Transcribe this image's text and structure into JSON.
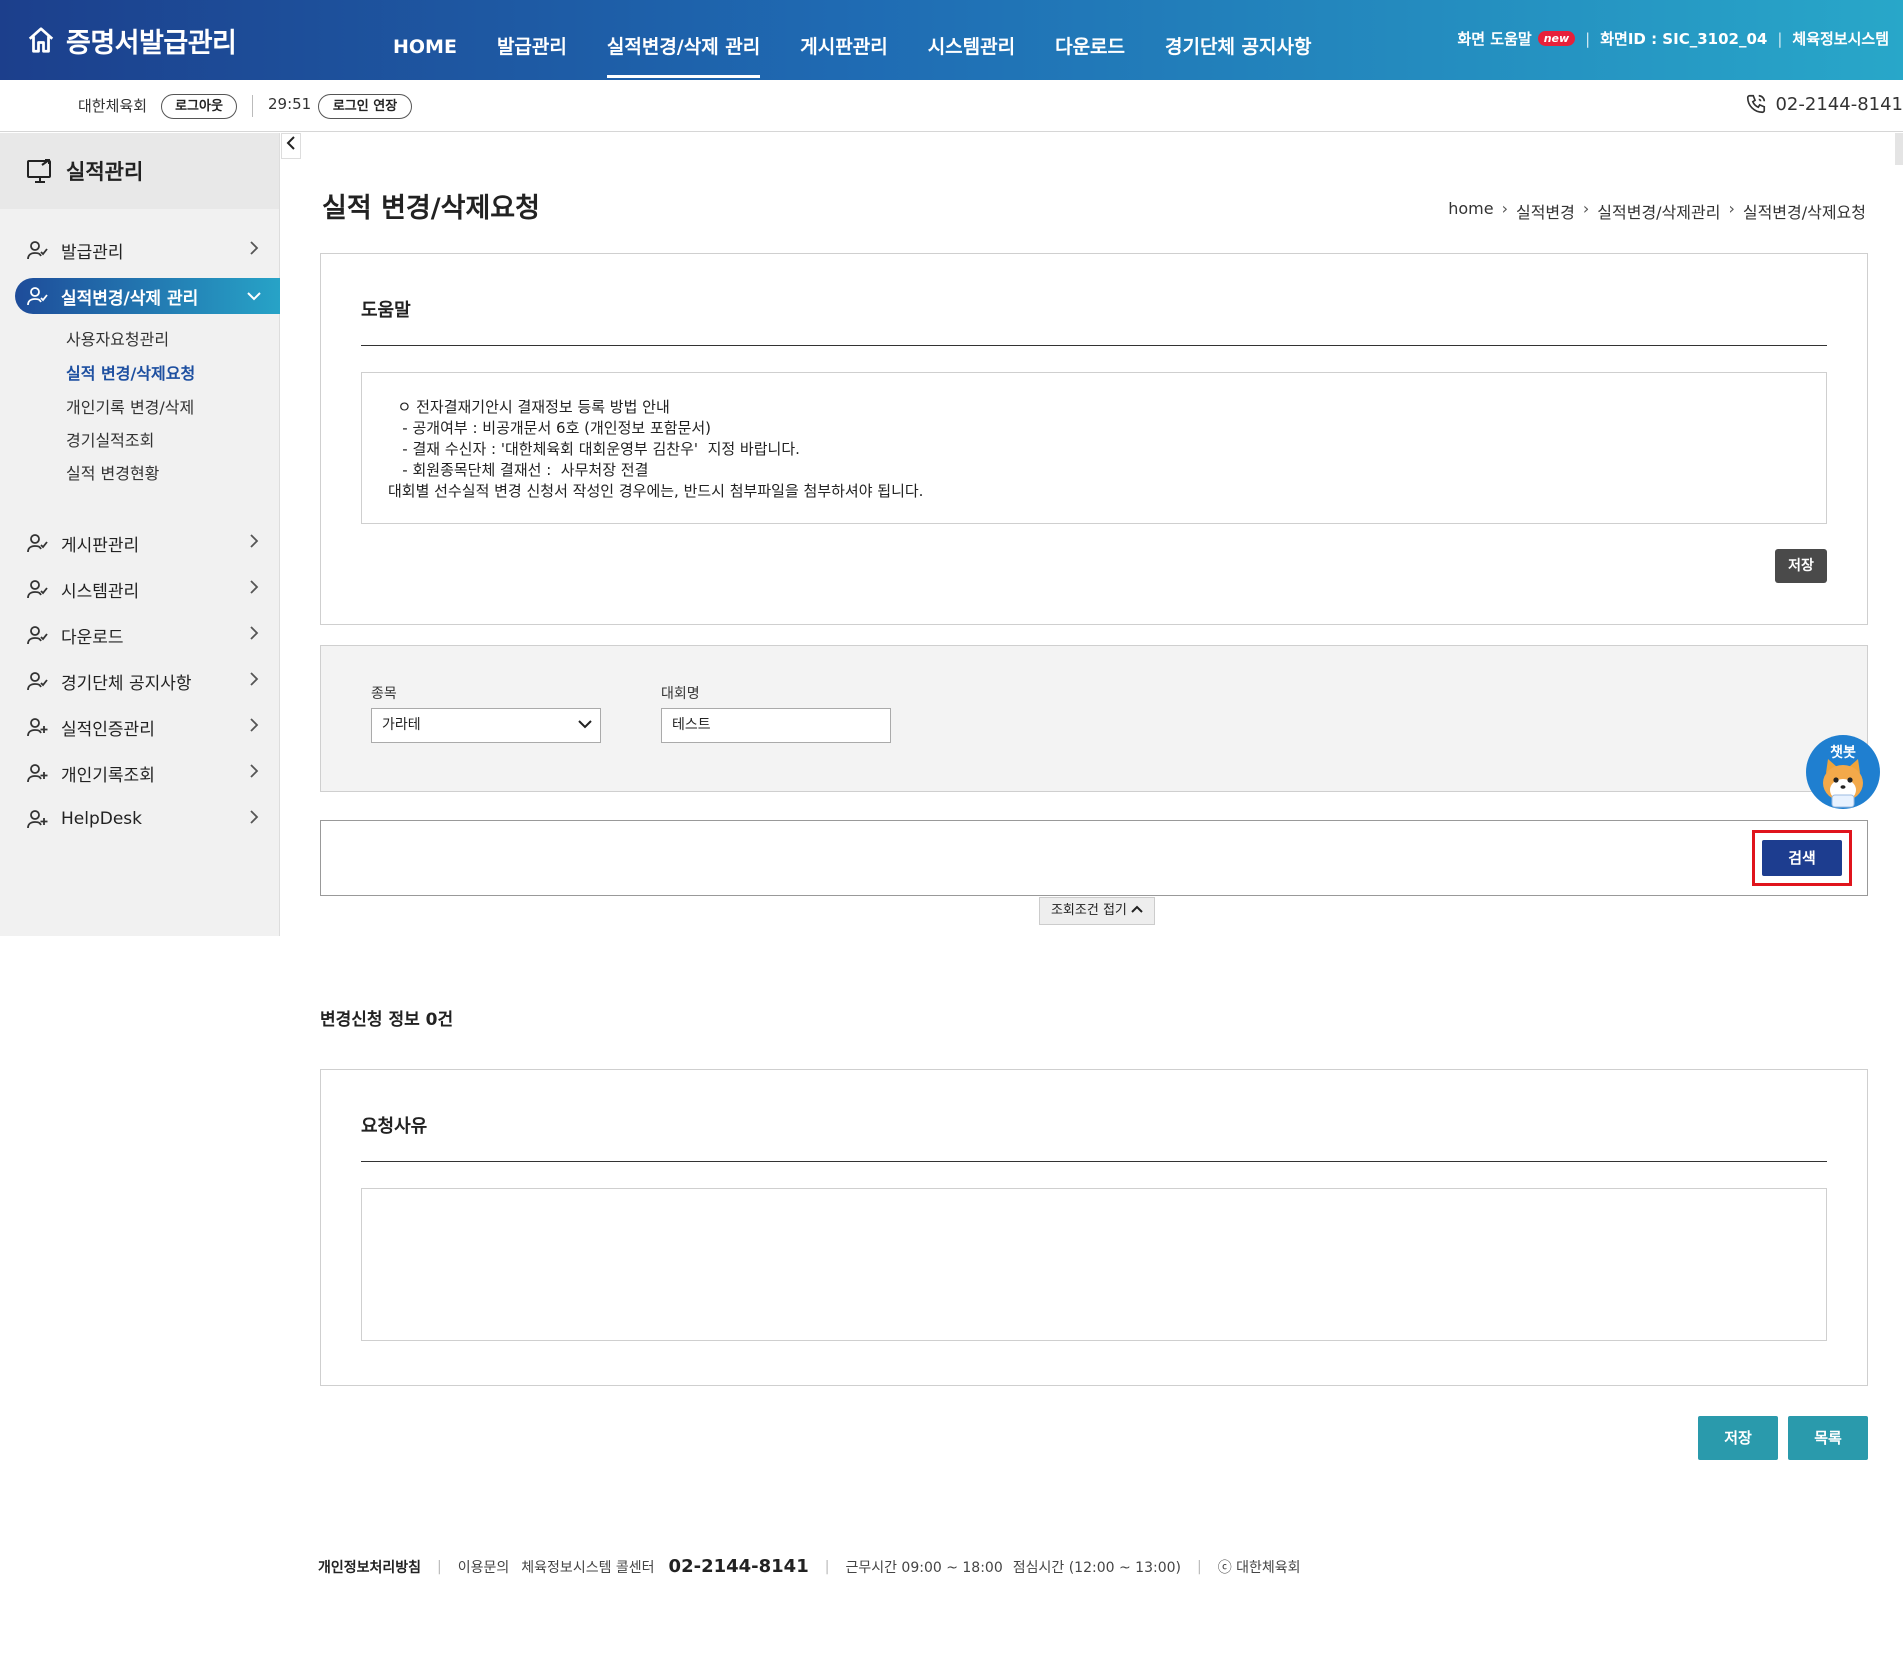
{
  "header": {
    "app_title": "증명서발급관리",
    "nav": [
      "HOME",
      "발급관리",
      "실적변경/삭제 관리",
      "게시판관리",
      "시스템관리",
      "다운로드",
      "경기단체 공지사항"
    ],
    "active_nav_index": 2,
    "util_help": "화면 도움말",
    "util_new_badge": "new",
    "util_screen_id": "화면ID : SIC_3102_04",
    "util_system": "체육정보시스템"
  },
  "subbar": {
    "org": "대한체육회",
    "logout": "로그아웃",
    "timer": "29:51",
    "extend": "로그인 연장",
    "phone": "02-2144-8141"
  },
  "sidebar": {
    "title": "실적관리",
    "items": [
      {
        "label": "발급관리",
        "icon": "user-check-icon"
      },
      {
        "label": "실적변경/삭제 관리",
        "icon": "user-check-icon"
      },
      {
        "label": "게시판관리",
        "icon": "user-check-icon"
      },
      {
        "label": "시스템관리",
        "icon": "user-check-icon"
      },
      {
        "label": "다운로드",
        "icon": "user-check-icon"
      },
      {
        "label": "경기단체 공지사항",
        "icon": "user-check-icon"
      },
      {
        "label": "실적인증관리",
        "icon": "user-plus-icon"
      },
      {
        "label": "개인기록조회",
        "icon": "user-plus-icon"
      },
      {
        "label": "HelpDesk",
        "icon": "user-plus-icon"
      }
    ],
    "subitems": [
      "사용자요청관리",
      "실적 변경/삭제요청",
      "개인기록 변경/삭제",
      "경기실적조회",
      "실적 변경현황"
    ],
    "active_sub_index": 1
  },
  "page": {
    "title": "실적 변경/삭제요청",
    "breadcrumb": [
      "home",
      "실적변경",
      "실적변경/삭제관리",
      "실적변경/삭제요청"
    ]
  },
  "help_panel": {
    "title": "도움말",
    "lines": [
      "  ㅇ 전자결재기안시 결재정보 등록 방법 안내",
      "   - 공개여부 : 비공개문서 6호 (개인정보 포함문서)",
      "   - 결재 수신자 : '대한체육회 대회운영부 김찬우'  지정 바랍니다.",
      "   - 회원종목단체 결재선 :  사무처장 전결",
      "대회별 선수실적 변경 신청서 작성인 경우에는, 반드시 첨부파일을 첨부하셔야 됩니다."
    ],
    "save_label": "저장"
  },
  "search": {
    "sport_label": "종목",
    "sport_value": "가라테",
    "event_label": "대회명",
    "event_value": "테스트",
    "search_label": "검색",
    "fold_label": "조회조건 접기"
  },
  "result": {
    "count_label": "변경신청 정보 0건"
  },
  "reason_panel": {
    "title": "요청사유",
    "value": ""
  },
  "actions": {
    "save": "저장",
    "list": "목록"
  },
  "chatbot": {
    "label": "챗봇"
  },
  "footer": {
    "privacy": "개인정보처리방침",
    "inquiry": "이용문의",
    "callcenter": "체육정보시스템 콜센터",
    "tel": "02-2144-8141",
    "hours": "근무시간 09:00 ~ 18:00",
    "lunch": "점심시간 (12:00 ~ 13:00)",
    "copyright": "ⓒ 대한체육회"
  },
  "colors": {
    "header_start": "#1c3f8c",
    "header_end": "#28a7c9",
    "primary_button": "#1d3d8f",
    "teal_button": "#2a9aac",
    "highlight": "#e0141c"
  }
}
